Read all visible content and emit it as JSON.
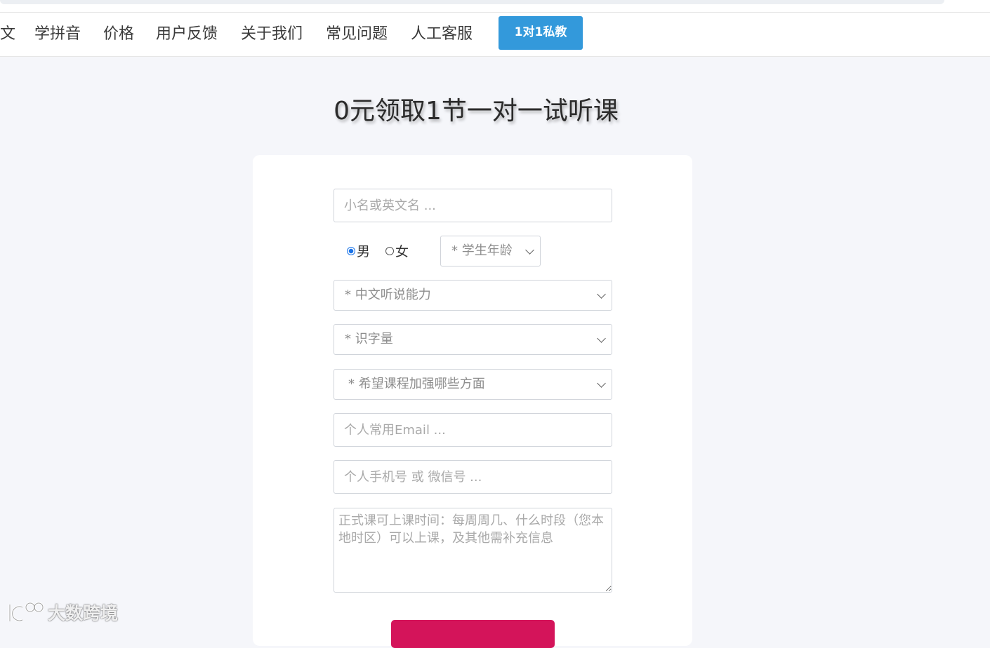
{
  "nav": {
    "items": [
      {
        "label": "文"
      },
      {
        "label": "学拼音"
      },
      {
        "label": "价格"
      },
      {
        "label": "用户反馈"
      },
      {
        "label": "关于我们"
      },
      {
        "label": "常见问题"
      },
      {
        "label": "人工客服"
      }
    ],
    "cta_label": "1对1私教",
    "cta_color": "#3399db"
  },
  "page": {
    "title": "0元领取1节一对一试听课",
    "background": "#f5f6fa"
  },
  "form": {
    "name_placeholder": "小名或英文名 ...",
    "gender": {
      "options": [
        "男",
        "女"
      ],
      "selected": "男"
    },
    "age_select": "* 学生年龄",
    "chinese_ability_select": "* 中文听说能力",
    "literacy_select": "* 识字量",
    "focus_select": "* 希望课程加强哪些方面",
    "email_placeholder": "个人常用Email ...",
    "phone_placeholder": "个人手机号 或 微信号 ...",
    "schedule_placeholder": "正式课可上课时间：每周周几、什么时段（您本地时区）可以上课，及其他需补充信息",
    "submit_color": "#d4145a"
  },
  "watermark": {
    "text": "大数跨境",
    "icon": "logo-icon"
  }
}
